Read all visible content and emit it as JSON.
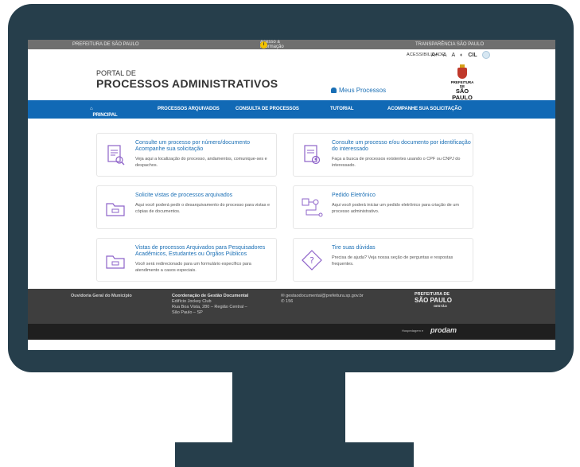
{
  "topbar": {
    "left": "PREFEITURA DE SÃO PAULO",
    "center": "Acesso à informação",
    "right": "TRANSPARÊNCIA SÃO PAULO"
  },
  "accessibility": {
    "label": "ACESSIBILIDADE",
    "buttons": [
      "A+",
      "A",
      "A",
      "◐",
      "CIL"
    ]
  },
  "header": {
    "portal_small": "PORTAL DE",
    "portal_big": "PROCESSOS ADMINISTRATIVOS",
    "my_processes": "Meus Processos",
    "logo_line1": "PREFEITURA DE",
    "logo_line2": "SÃO PAULO"
  },
  "nav": {
    "items": [
      "PRINCIPAL",
      "PROCESSOS ARQUIVADOS",
      "CONSULTA DE PROCESSOS",
      "TUTORIAL",
      "ACOMPANHE SUA SOLICITAÇÃO"
    ]
  },
  "cards": [
    {
      "title": "Consulte um processo por número/documento Acompanhe sua solicitação",
      "desc": "Veja aqui a localização do processo, andamentos, comunique-ses e despachos.",
      "icon": "document-search-icon"
    },
    {
      "title": "Consulte um processo e/ou documento por identificação do interessado",
      "desc": "Faça a busca de processos existentes usando o CPF ou CNPJ do interessado.",
      "icon": "document-person-icon"
    },
    {
      "title": "Solicite vistas de processos arquivados",
      "desc": "Aqui você poderá pedir o desarquivamento do processo para vistas e cópias de documentos.",
      "icon": "archive-folder-icon"
    },
    {
      "title": "Pedido Eletrônico",
      "desc": "Aqui você poderá iniciar um pedido eletrônico para criação de um processo administrativo.",
      "icon": "flow-icon"
    },
    {
      "title": "Vistas de processos Arquivados para Pesquisadores Acadêmicos, Estudantes ou Órgãos Públicos",
      "desc": "Você será redirecionado para um formulário específico para atendimento a casos especiais.",
      "icon": "archive-folder-icon"
    },
    {
      "title": "Tire suas dúvidas",
      "desc": "Precisa de ajuda? Veja nossa seção de perguntas e respostas frequentes.",
      "icon": "question-icon"
    }
  ],
  "footer": {
    "ouvidoria": "Ouvidoria Geral do Município",
    "coord_title": "Coordenação de Gestão Documental",
    "coord_line1": "Edifício Jockey Club",
    "coord_line2": "Rua Boa Vista, 280 – Região Central –",
    "coord_line3": "São Paulo – SP",
    "email": "gestaodocumental@prefeitura.sp.gov.br",
    "phone": "156",
    "logo_line1": "PREFEITURA DE",
    "logo_line2": "SÃO PAULO",
    "logo_line3": "GESTÃO",
    "host_label": "Hospedagem e",
    "host_brand": "prodam"
  },
  "colors": {
    "frame": "#263e4b",
    "nav": "#1169b5",
    "link": "#1a6fb5",
    "icon": "#8e63c9"
  }
}
